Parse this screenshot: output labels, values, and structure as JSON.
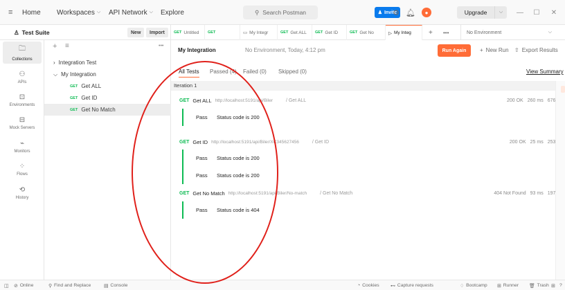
{
  "topbar": {
    "menu_icon": "hamburger-icon",
    "home": "Home",
    "workspaces": "Workspaces",
    "api_network": "API Network",
    "explore": "Explore",
    "search_placeholder": "Search Postman",
    "invite": "Invite",
    "upgrade": "Upgrade"
  },
  "workspace": {
    "name": "Test Suite",
    "new_btn": "New",
    "import_btn": "Import"
  },
  "tabs": [
    {
      "method": "GET",
      "label": "Untitled"
    },
    {
      "method": "GET",
      "label": ""
    },
    {
      "method": "",
      "label": "My Integr"
    },
    {
      "method": "GET",
      "label": "Get ALL"
    },
    {
      "method": "GET",
      "label": "Get ID"
    },
    {
      "method": "GET",
      "label": "Get No"
    },
    {
      "method": "",
      "label": "My Integ"
    }
  ],
  "environment": "No Environment",
  "rail": [
    {
      "label": "Collections",
      "icon": "collections-icon"
    },
    {
      "label": "APIs",
      "icon": "apis-icon"
    },
    {
      "label": "Environments",
      "icon": "environments-icon"
    },
    {
      "label": "Mock Servers",
      "icon": "mock-servers-icon"
    },
    {
      "label": "Monitors",
      "icon": "monitors-icon"
    },
    {
      "label": "Flows",
      "icon": "flows-icon"
    },
    {
      "label": "History",
      "icon": "history-icon"
    }
  ],
  "tree": {
    "integration_test": "Integration Test",
    "my_integration": "My Integration",
    "requests": [
      {
        "method": "GET",
        "name": "Get ALL"
      },
      {
        "method": "GET",
        "name": "Get ID"
      },
      {
        "method": "GET",
        "name": "Get No Match"
      }
    ]
  },
  "run": {
    "title": "My Integration",
    "meta": "No Environment, Today, 4:12 pm",
    "run_again": "Run Again",
    "new_run": "New Run",
    "export": "Export Results",
    "tabs": [
      "All Tests",
      "Passed (4)",
      "Failed (0)",
      "Skipped (0)"
    ],
    "view_summary": "View Summary",
    "iteration": "Iteration 1",
    "requests": [
      {
        "method": "GET",
        "name": "Get ALL",
        "url": "http://localhost:5191/api/Biler",
        "dest": "/ Get ALL",
        "status": "200 OK",
        "time": "260 ms",
        "size": "676 B",
        "asserts": [
          {
            "result": "Pass",
            "text": "Status code is 200"
          }
        ]
      },
      {
        "method": "GET",
        "name": "Get ID",
        "url": "http://localhost:5191/api/Biler/XC345627456",
        "dest": "/ Get ID",
        "status": "200 OK",
        "time": "25 ms",
        "size": "253 B",
        "asserts": [
          {
            "result": "Pass",
            "text": "Status code is 200"
          },
          {
            "result": "Pass",
            "text": "Status code is 200"
          }
        ]
      },
      {
        "method": "GET",
        "name": "Get No Match",
        "url": "http://localhost:5191/api/Biler/No-match",
        "dest": "/ Get No Match",
        "status": "404 Not Found",
        "time": "93 ms",
        "size": "197 B",
        "asserts": [
          {
            "result": "Pass",
            "text": "Status code is 404"
          }
        ]
      }
    ]
  },
  "statusbar": {
    "online": "Online",
    "find_replace": "Find and Replace",
    "console": "Console",
    "cookies": "Cookies",
    "capture": "Capture requests",
    "bootcamp": "Bootcamp",
    "runner": "Runner",
    "trash": "Trash"
  },
  "colors": {
    "accent": "#ff6c37",
    "get_method": "#0cbb52",
    "invite": "#097bed",
    "annotation": "#e0201a"
  }
}
